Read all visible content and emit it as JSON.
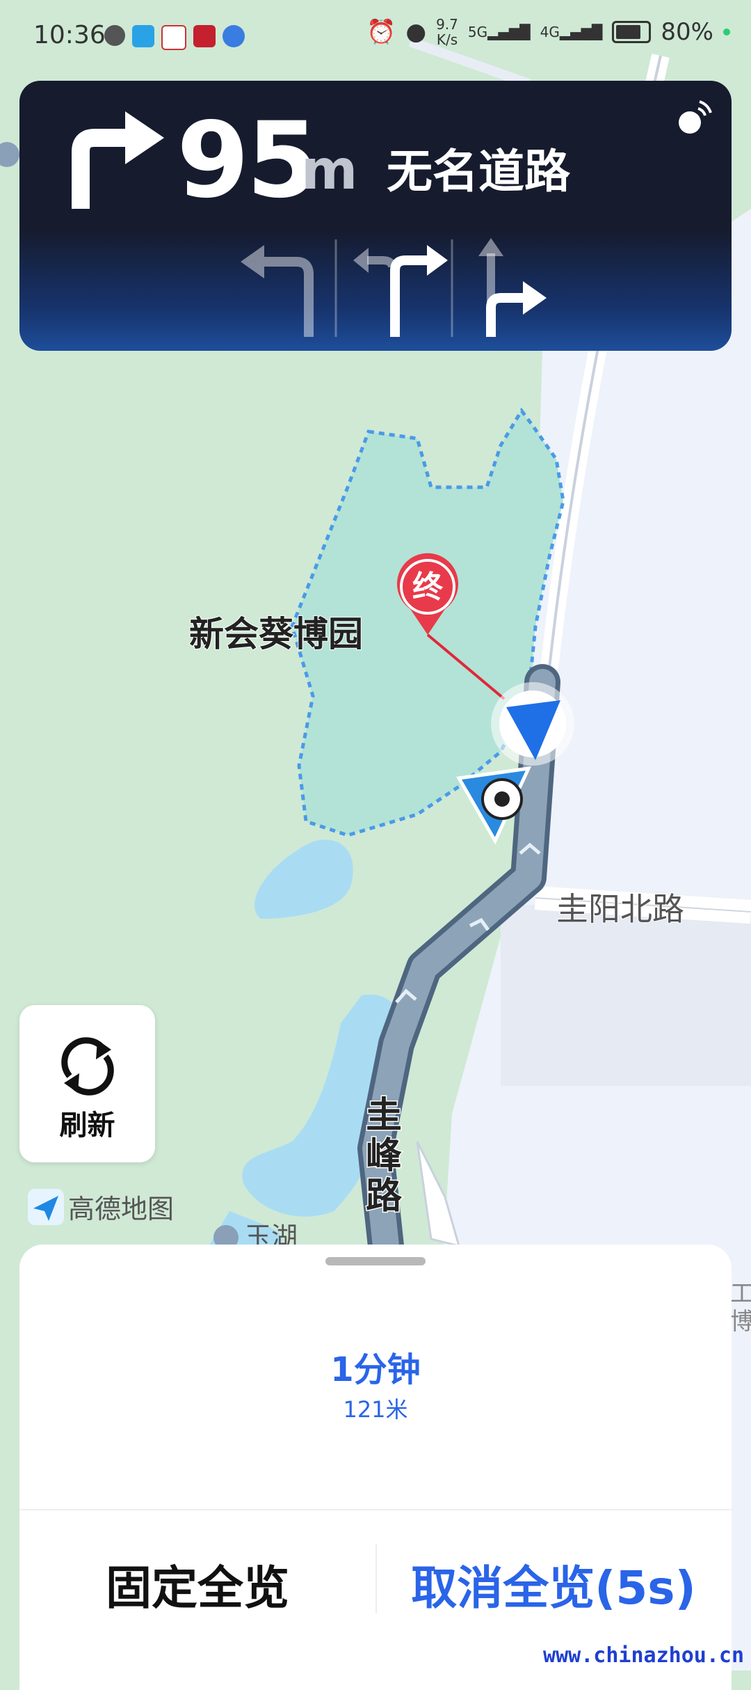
{
  "status_bar": {
    "time": "10:36",
    "net_speed_value": "9.7",
    "net_speed_unit": "K/s",
    "signal_1": "5G",
    "signal_2": "4G",
    "battery": "80%"
  },
  "guidance": {
    "distance": "95",
    "unit": "m",
    "road_name": "无名道路",
    "lanes": [
      "left-turn",
      "left-or-right",
      "straight-or-right"
    ]
  },
  "map": {
    "park_name": "新会葵博园",
    "destination_marker": "终",
    "road_guiyang_north": "圭阳北路",
    "road_guifeng": "圭峰路",
    "poi_yuhu": "玉湖",
    "edge_chars": [
      "工",
      "博"
    ]
  },
  "refresh_button": {
    "label": "刷新"
  },
  "brand": {
    "name": "高德地图"
  },
  "bottom_sheet": {
    "eta_time": "1分钟",
    "eta_distance": "121米",
    "fix_overview": "固定全览",
    "cancel_overview": "取消全览(5s)"
  },
  "watermark": "www.chinazhou.cn",
  "colors": {
    "accent_blue": "#2a64e8",
    "park_fill": "#b3e3d6",
    "water": "#a9dcf3",
    "route": "#7f95aa",
    "destination_red": "#e83a4a"
  }
}
